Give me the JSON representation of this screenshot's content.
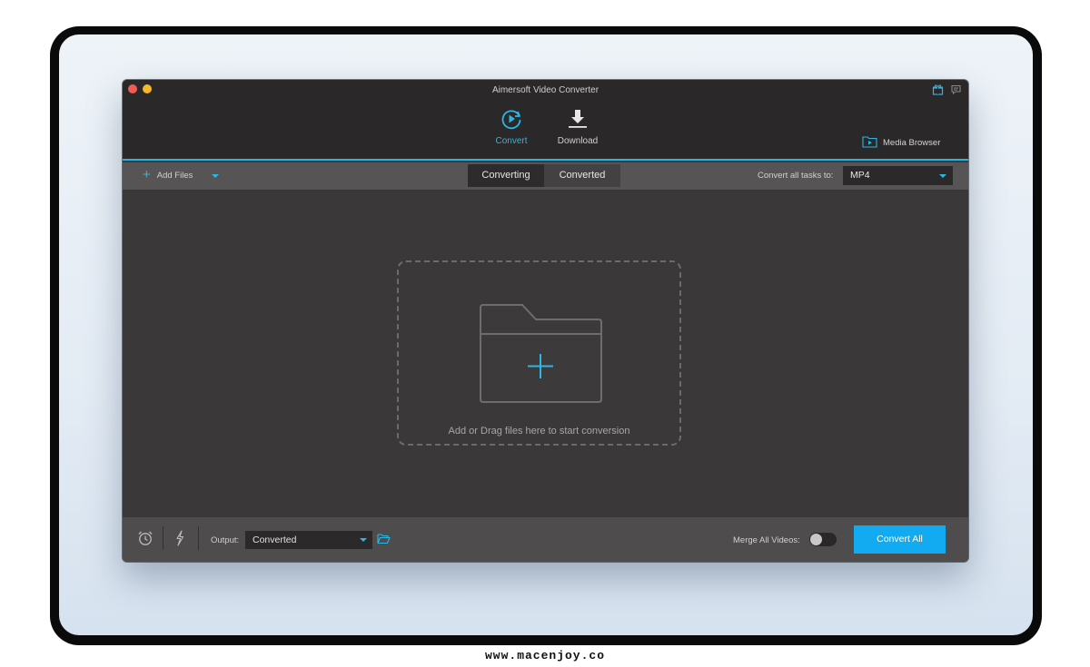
{
  "window": {
    "title": "Aimersoft Video Converter"
  },
  "top_tabs": [
    {
      "label": "Convert",
      "icon": "convert-icon",
      "active": true
    },
    {
      "label": "Download",
      "icon": "download-icon",
      "active": false
    }
  ],
  "media_browser": {
    "label": "Media Browser",
    "icon": "media-browser-icon"
  },
  "toolbar": {
    "add_files_label": "Add Files",
    "segments": [
      "Converting",
      "Converted"
    ],
    "convert_all_tasks_label": "Convert all tasks to:",
    "format_value": "MP4"
  },
  "dropzone": {
    "text": "Add or Drag files here to start conversion"
  },
  "bottombar": {
    "output_label": "Output:",
    "output_value": "Converted",
    "merge_label": "Merge All Videos:",
    "merge_enabled": false,
    "convert_all_label": "Convert All"
  },
  "watermark": "www.macenjoy.co",
  "colors": {
    "accent": "#2bb7e4",
    "convert_button": "#12aaf0",
    "window_bg": "#3b3839",
    "titlebar_bg": "#2b2829"
  }
}
